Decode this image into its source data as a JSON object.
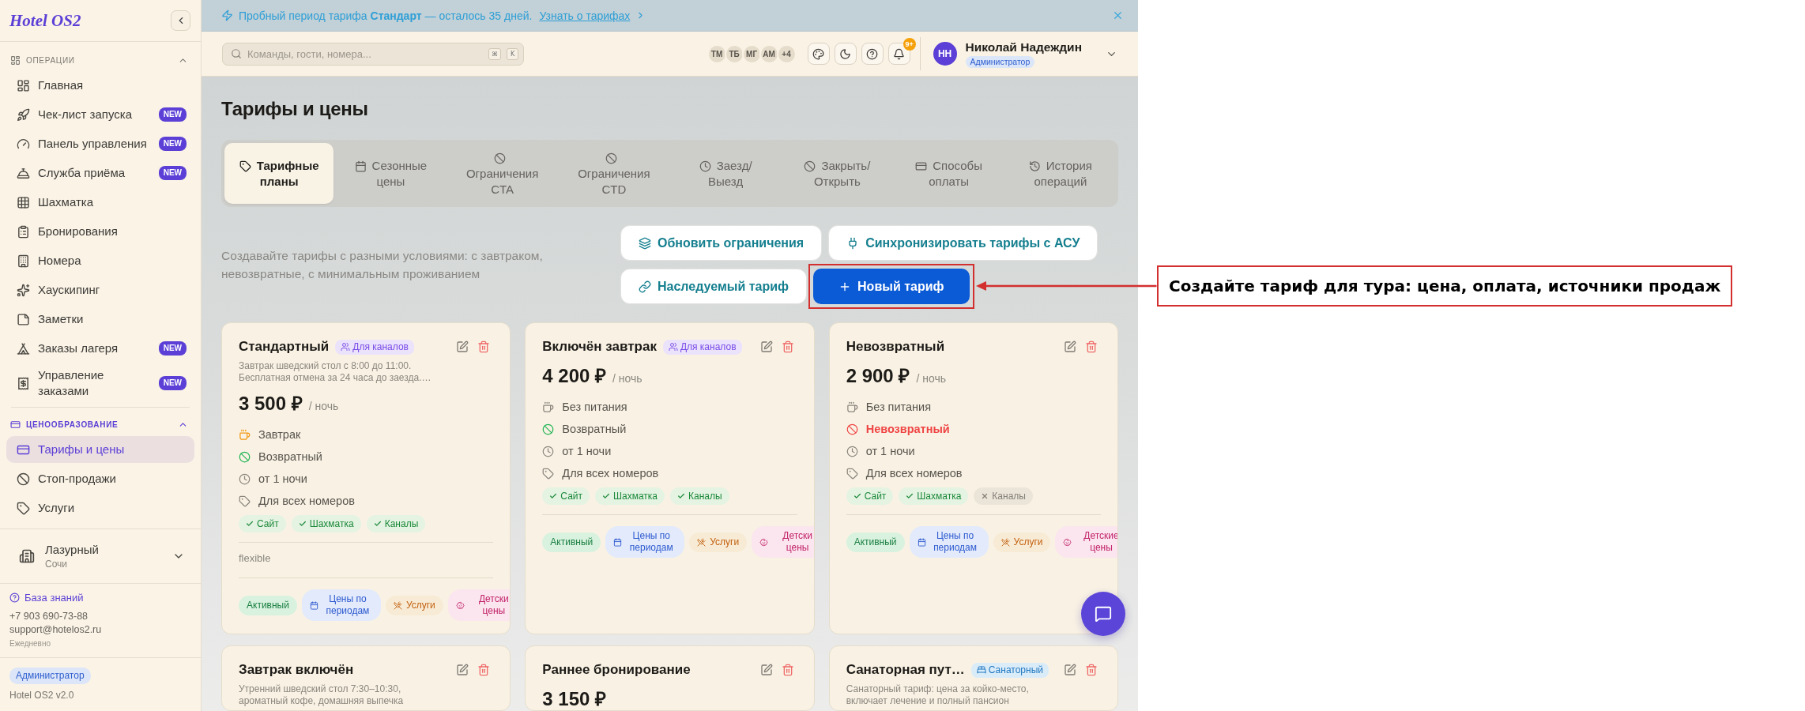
{
  "sidebar": {
    "logo": "Hotel OS2",
    "sections": [
      {
        "title": "ОПЕРАЦИИ",
        "expanded": true,
        "items": [
          {
            "label": "Главная",
            "selected": false
          },
          {
            "label": "Чек-лист запуска",
            "badge": "NEW",
            "selected": false
          },
          {
            "label": "Панель управления",
            "badge": "NEW",
            "selected": false
          },
          {
            "label": "Служба приёма",
            "badge": "NEW",
            "selected": false
          },
          {
            "label": "Шахматка",
            "selected": false
          },
          {
            "label": "Бронирования",
            "selected": false
          },
          {
            "label": "Номера",
            "selected": false
          },
          {
            "label": "Хаускипинг",
            "selected": false
          },
          {
            "label": "Заметки",
            "selected": false
          },
          {
            "label": "Заказы лагеря",
            "badge": "NEW",
            "selected": false
          },
          {
            "label": "Управление заказами",
            "badge": "NEW",
            "selected": false
          }
        ]
      },
      {
        "title": "ЦЕНООБРАЗОВАНИЕ",
        "expanded": true,
        "items": [
          {
            "label": "Тарифы и цены",
            "selected": true
          },
          {
            "label": "Стоп-продажи",
            "selected": false
          },
          {
            "label": "Услуги",
            "selected": false
          }
        ]
      }
    ],
    "property": {
      "name": "Лазурный",
      "city": "Сочи"
    },
    "support": {
      "link": "База знаний",
      "phone": "+7 903 690-73-88",
      "email": "support@hotelos2.ru",
      "hours": "Ежедневно"
    },
    "footer": {
      "role": "Администратор",
      "version": "Hotel OS2 v2.0"
    }
  },
  "banner": {
    "text": "Пробный период тарифа **Стандарт** — осталось 35 дней.",
    "link": "Узнать о тарифах"
  },
  "topbar": {
    "search": {
      "placeholder": "Команды, гости, номера...",
      "keys": [
        "⌘",
        "K"
      ]
    },
    "presence": [
      "ТМ",
      "ТБ",
      "МГ",
      "АМ"
    ],
    "presence_more": "+4",
    "notifications": "9+",
    "user": {
      "initials": "НН",
      "name": "Николай Надеждин",
      "role": "Администратор"
    }
  },
  "page": {
    "title": "Тарифы и цены",
    "tabs": [
      {
        "label": "Тарифные планы",
        "selected": true
      },
      {
        "label": "Сезонные цены",
        "selected": false
      },
      {
        "label": "Ограничения CTA",
        "selected": false
      },
      {
        "label": "Ограничения CTD",
        "selected": false
      },
      {
        "label": "Заезд/Выезд",
        "selected": false
      },
      {
        "label": "Закрыть/Открыть",
        "selected": false
      },
      {
        "label": "Способы оплаты",
        "selected": false
      },
      {
        "label": "История операций",
        "selected": false
      }
    ],
    "description": "Создавайте тарифы с разными условиями: с завтраком, невозвратные, с минимальным проживанием",
    "actions": [
      {
        "kind": "secondary",
        "label": "Обновить ограничения",
        "highlighted": false
      },
      {
        "kind": "secondary",
        "label": "Синхронизировать тарифы с АСУ",
        "highlighted": false
      },
      {
        "kind": "secondary",
        "label": "Наследуемый тариф",
        "highlighted": false
      },
      {
        "kind": "primary",
        "label": "Новый тариф",
        "highlighted": true
      }
    ]
  },
  "rate_cards": [
    {
      "name": "Стандартный",
      "badge": {
        "kind": "channels",
        "label": "Для каналов"
      },
      "description": "Завтрак шведский стол с 8:00 до 11:00.\nБесплатная отмена за 24 часа до заезда.…",
      "price": "3 500 ₽",
      "unit": "/ ночь",
      "meal": {
        "label": "Завтрак",
        "included": true
      },
      "refund": {
        "label": "Возвратный",
        "refundable": true
      },
      "min_stay": "от 1 ночи",
      "rooms": "Для всех номеров",
      "channels": [
        {
          "label": "Сайт",
          "enabled": true
        },
        {
          "label": "Шахматка",
          "enabled": true
        },
        {
          "label": "Каналы",
          "enabled": true
        }
      ],
      "note": "flexible",
      "tags": [
        {
          "kind": "status",
          "label": "Активный"
        },
        {
          "kind": "periods",
          "label": "Цены по периодам"
        },
        {
          "kind": "services",
          "label": "Услуги"
        },
        {
          "kind": "children",
          "label": "Детски цены"
        }
      ]
    },
    {
      "name": "Включён завтрак",
      "badge": {
        "kind": "channels",
        "label": "Для каналов"
      },
      "price": "4 200 ₽",
      "unit": "/ ночь",
      "meal": {
        "label": "Без питания",
        "included": false
      },
      "refund": {
        "label": "Возвратный",
        "refundable": true
      },
      "min_stay": "от 1 ночи",
      "rooms": "Для всех номеров",
      "channels": [
        {
          "label": "Сайт",
          "enabled": true
        },
        {
          "label": "Шахматка",
          "enabled": true
        },
        {
          "label": "Каналы",
          "enabled": true
        }
      ],
      "tags": [
        {
          "kind": "status",
          "label": "Активный"
        },
        {
          "kind": "periods",
          "label": "Цены по периодам"
        },
        {
          "kind": "services",
          "label": "Услуги"
        },
        {
          "kind": "children",
          "label": "Детски цены"
        }
      ]
    },
    {
      "name": "Невозвратный",
      "price": "2 900 ₽",
      "unit": "/ ночь",
      "meal": {
        "label": "Без питания",
        "included": false
      },
      "refund": {
        "label": "Невозвратный",
        "refundable": false
      },
      "min_stay": "от 1 ночи",
      "rooms": "Для всех номеров",
      "channels": [
        {
          "label": "Сайт",
          "enabled": true
        },
        {
          "label": "Шахматка",
          "enabled": true
        },
        {
          "label": "Каналы",
          "enabled": false
        }
      ],
      "tags": [
        {
          "kind": "status",
          "label": "Активный"
        },
        {
          "kind": "periods",
          "label": "Цены по периодам"
        },
        {
          "kind": "services",
          "label": "Услуги"
        },
        {
          "kind": "children",
          "label": "Детские цены"
        }
      ]
    },
    {
      "name": "Завтрак включён",
      "description": "Утренний шведский стол 7:30–10:30,\nароматный кофе, домашняя выпечка"
    },
    {
      "name": "Раннее бронирование",
      "price": "3 150 ₽"
    },
    {
      "name": "Санаторная пут…",
      "badge": {
        "kind": "sanatorium",
        "label": "Санаторный"
      },
      "description": "Санаторный тариф: цена за койко-место,\nвключает лечение и полный пансион"
    }
  ],
  "callout": {
    "text": "Создайте тариф для тура: цена, оплата, источники продаж"
  }
}
